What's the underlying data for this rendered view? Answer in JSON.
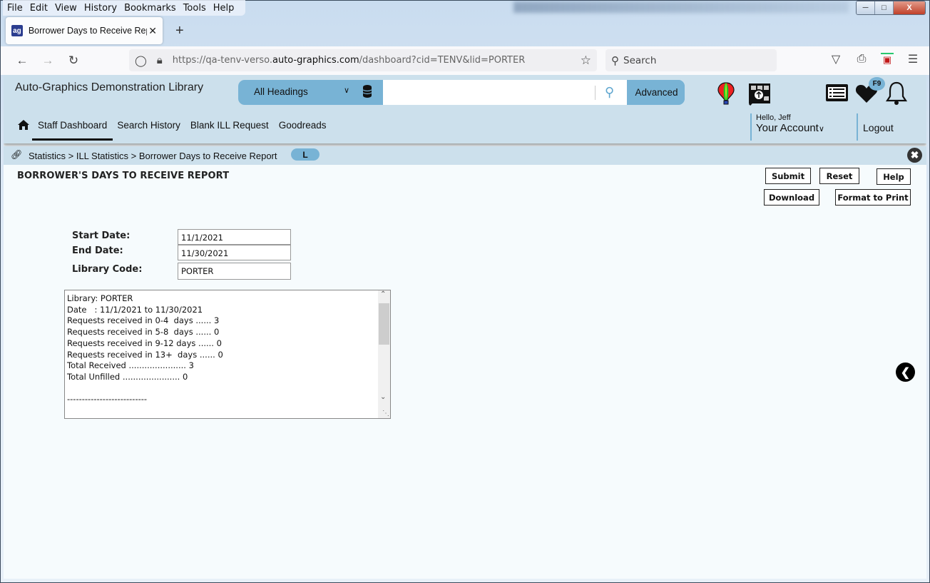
{
  "browser": {
    "menu": [
      "File",
      "Edit",
      "View",
      "History",
      "Bookmarks",
      "Tools",
      "Help"
    ],
    "tab_title": "Borrower Days to Receive Report",
    "favicon_text": "ag",
    "url_prefix": "https://qa-tenv-verso.",
    "url_domain": "auto-graphics.com",
    "url_suffix": "/dashboard?cid=TENV&lid=PORTER",
    "search_placeholder": "Search"
  },
  "header": {
    "library_name": "Auto-Graphics Demonstration Library",
    "search_scope": "All Headings",
    "search_value": "",
    "advanced_label": "Advanced",
    "f9_badge": "F9"
  },
  "nav": {
    "items": [
      "Staff Dashboard",
      "Search History",
      "Blank ILL Request",
      "Goodreads"
    ],
    "hello": "Hello, Jeff",
    "account": "Your Account",
    "logout": "Logout"
  },
  "breadcrumb": {
    "path": "Statistics > ILL Statistics > Borrower Days to Receive Report",
    "pill": "L"
  },
  "page": {
    "title": "BORROWER'S DAYS TO RECEIVE REPORT",
    "buttons": {
      "submit": "Submit",
      "reset": "Reset",
      "help": "Help",
      "download": "Download",
      "format_print": "Format to Print"
    },
    "form": {
      "start_date_label": "Start Date:",
      "start_date": "11/1/2021",
      "end_date_label": "End Date:",
      "end_date": "11/30/2021",
      "library_code_label": "Library Code:",
      "library_code": "PORTER"
    },
    "report_text": "Library: PORTER\nDate   : 11/1/2021 to 11/30/2021\nRequests received in 0-4  days ...... 3\nRequests received in 5-8  days ...... 0\nRequests received in 9-12 days ...... 0\nRequests received in 13+  days ...... 0\nTotal Received ...................... 3\nTotal Unfilled ...................... 0\n\n---------------------------"
  }
}
